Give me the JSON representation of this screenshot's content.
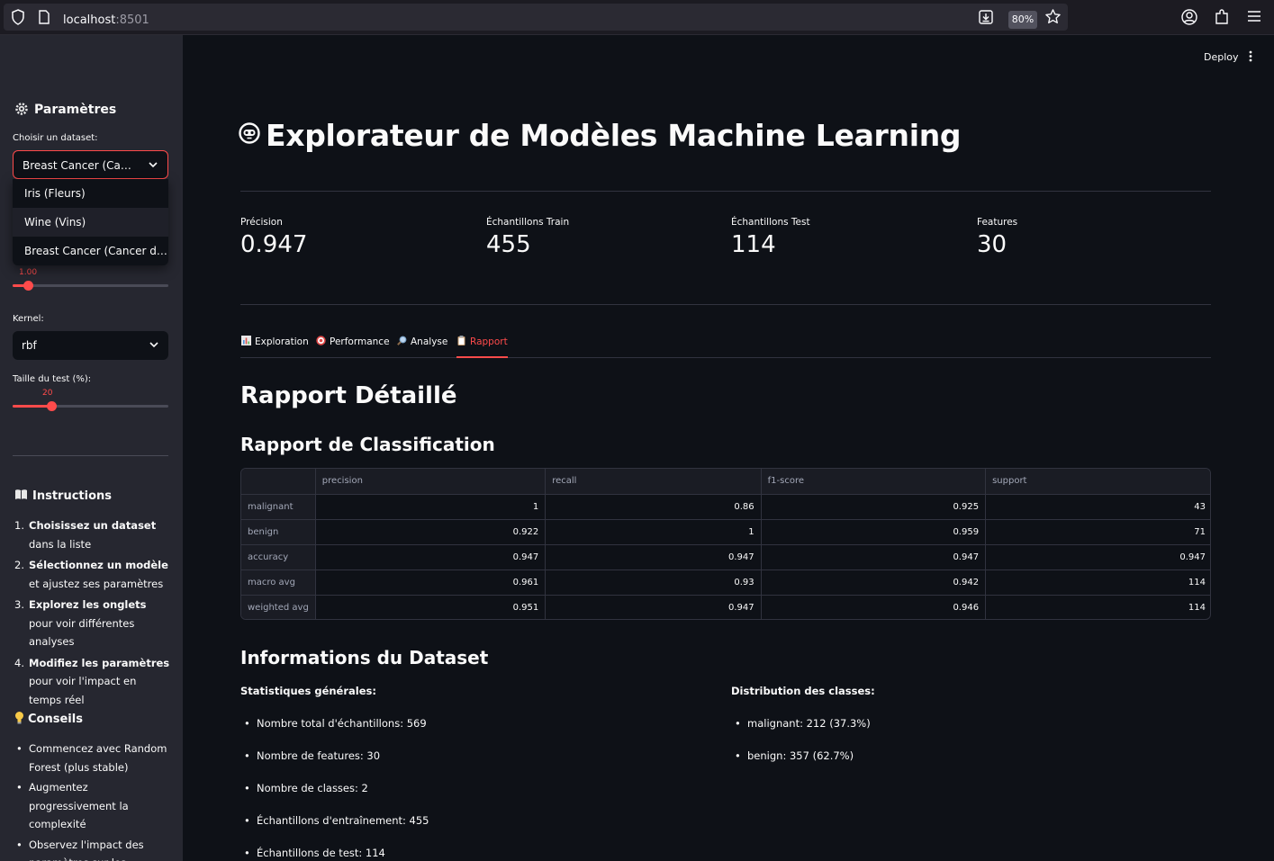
{
  "browser": {
    "url_host": "localhost",
    "url_port": ":8501",
    "zoom": "80%"
  },
  "sidebar": {
    "title": "Paramètres",
    "dataset_label": "Choisir un dataset:",
    "dataset_selected": "Breast Cancer (Cancer du sein)",
    "dataset_options": [
      "Iris (Fleurs)",
      "Wine (Vins)",
      "Breast Cancer (Cancer du sein)"
    ],
    "c_slider_value": "1.00",
    "c_slider_fraction": 0.1,
    "kernel_label": "Kernel:",
    "kernel_value": "rbf",
    "test_size_label": "Taille du test (%):",
    "test_size_value": "20",
    "test_size_fraction": 0.25,
    "instructions_title": "Instructions",
    "instructions": [
      {
        "num": "1.",
        "bold": "Choisissez un dataset",
        "rest": " dans la liste"
      },
      {
        "num": "2.",
        "bold": "Sélectionnez un modèle",
        "rest": " et ajustez ses paramètres"
      },
      {
        "num": "3.",
        "bold": "Explorez les onglets",
        "rest": " pour voir différentes analyses"
      },
      {
        "num": "4.",
        "bold": "Modifiez les paramètres",
        "rest": " pour voir l'impact en temps réel"
      }
    ],
    "tips_title": "Conseils",
    "tips": [
      "Commencez avec Random Forest (plus stable)",
      "Augmentez progressivement la complexité",
      "Observez l'impact des paramètres sur les"
    ]
  },
  "header": {
    "deploy_label": "Deploy"
  },
  "main": {
    "title": "Explorateur de Modèles Machine Learning",
    "metrics": [
      {
        "label": "Précision",
        "value": "0.947"
      },
      {
        "label": "Échantillons Train",
        "value": "455"
      },
      {
        "label": "Échantillons Test",
        "value": "114"
      },
      {
        "label": "Features",
        "value": "30"
      }
    ],
    "tabs": [
      {
        "label": "Exploration",
        "icon": "bar-chart-icon"
      },
      {
        "label": "Performance",
        "icon": "target-icon"
      },
      {
        "label": "Analyse",
        "icon": "magnifier-icon"
      },
      {
        "label": "Rapport",
        "icon": "clipboard-icon"
      }
    ],
    "active_tab": "Rapport",
    "report_title": "Rapport Détaillé",
    "classification_title": "Rapport de Classification",
    "table": {
      "columns": [
        "",
        "precision",
        "recall",
        "f1-score",
        "support"
      ],
      "rows": [
        [
          "malignant",
          "1",
          "0.86",
          "0.925",
          "43"
        ],
        [
          "benign",
          "0.922",
          "1",
          "0.959",
          "71"
        ],
        [
          "accuracy",
          "0.947",
          "0.947",
          "0.947",
          "0.947"
        ],
        [
          "macro avg",
          "0.961",
          "0.93",
          "0.942",
          "114"
        ],
        [
          "weighted avg",
          "0.951",
          "0.947",
          "0.946",
          "114"
        ]
      ]
    },
    "dataset_info_title": "Informations du Dataset",
    "general_stats_title": "Statistiques générales:",
    "general_stats": [
      "Nombre total d'échantillons: 569",
      "Nombre de features: 30",
      "Nombre de classes: 2",
      "Échantillons d'entraînement: 455",
      "Échantillons de test: 114"
    ],
    "class_dist_title": "Distribution des classes:",
    "class_dist": [
      "malignant: 212 (37.3%)",
      "benign: 357 (62.7%)"
    ]
  },
  "colors": {
    "accent": "#ff4b4b",
    "background": "#0e1117",
    "sidebar": "#262730"
  }
}
